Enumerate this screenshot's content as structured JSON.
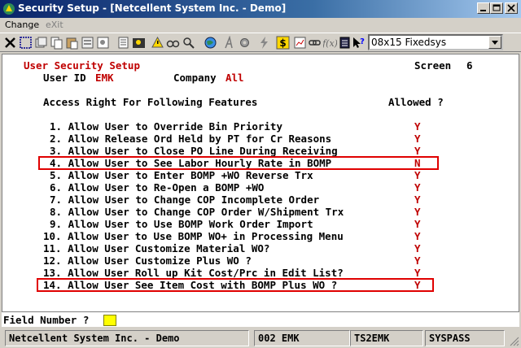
{
  "window": {
    "title": "Security Setup - [Netcellent System Inc. - Demo]"
  },
  "menu": {
    "change": "Change",
    "exit": "eXit"
  },
  "toolbar": {
    "font_select": "08x15 Fixedsys",
    "icons": [
      "close-x-icon",
      "select-rect-icon",
      "cut-icon",
      "copy-icon",
      "paste-icon",
      "print-preview-icon",
      "properties-icon",
      "notes-icon",
      "user-icon",
      "warning-icon",
      "binoculars-icon",
      "search-icon",
      "globe-icon",
      "italic-a-icon",
      "settings-icon",
      "lightning-icon",
      "dollar-icon",
      "report-icon",
      "link-icon",
      "function-icon",
      "calendar-icon",
      "help-pointer-icon"
    ]
  },
  "screen": {
    "heading": "User Security Setup",
    "screen_label": "Screen",
    "screen_number": "6",
    "user_id_label": "User ID",
    "user_id_value": "EMK",
    "company_label": "Company",
    "company_value": "All",
    "access_header": "Access Right For Following Features",
    "allowed_header": "Allowed ?",
    "items": [
      {
        "label": "1. Allow User to Override Bin Priority",
        "allowed": "Y"
      },
      {
        "label": "2. Allow Release Ord Held by PT for Cr Reasons",
        "allowed": "Y"
      },
      {
        "label": "3. Allow User to Close PO Line During Receiving",
        "allowed": "Y"
      },
      {
        "label": "4. Allow User to See Labor Hourly Rate in BOMP",
        "allowed": "N"
      },
      {
        "label": "5. Allow User to Enter BOMP +WO Reverse Trx",
        "allowed": "Y"
      },
      {
        "label": "6. Allow User to Re-Open a BOMP +WO",
        "allowed": "Y"
      },
      {
        "label": "7. Allow User to Change COP Incomplete Order",
        "allowed": "Y"
      },
      {
        "label": "8. Allow User to Change COP Order W/Shipment Trx",
        "allowed": "Y"
      },
      {
        "label": "9. Allow User to Use BOMP Work Order Import",
        "allowed": "Y"
      },
      {
        "label": "10. Allow User to Use BOMP WO+ in Processing Menu",
        "allowed": "Y"
      },
      {
        "label": "11. Allow User Customize Material WO?",
        "allowed": "Y"
      },
      {
        "label": "12. Allow User Customize Plus WO ?",
        "allowed": "Y"
      },
      {
        "label": "13. Allow User Roll up Kit Cost/Prc in Edit List?",
        "allowed": "Y"
      },
      {
        "label": "14. Allow User See Item Cost with BOMP Plus WO ?",
        "allowed": "Y"
      }
    ],
    "field_prompt": "Field Number ?"
  },
  "status": {
    "company": "Netcellent System Inc. - Demo",
    "user": "002 EMK",
    "terminal": "TS2EMK",
    "database": "SYSPASS"
  },
  "colors": {
    "highlight_box": "#e00000",
    "value_red": "#c00000",
    "cursor_yellow": "#ffff00"
  }
}
